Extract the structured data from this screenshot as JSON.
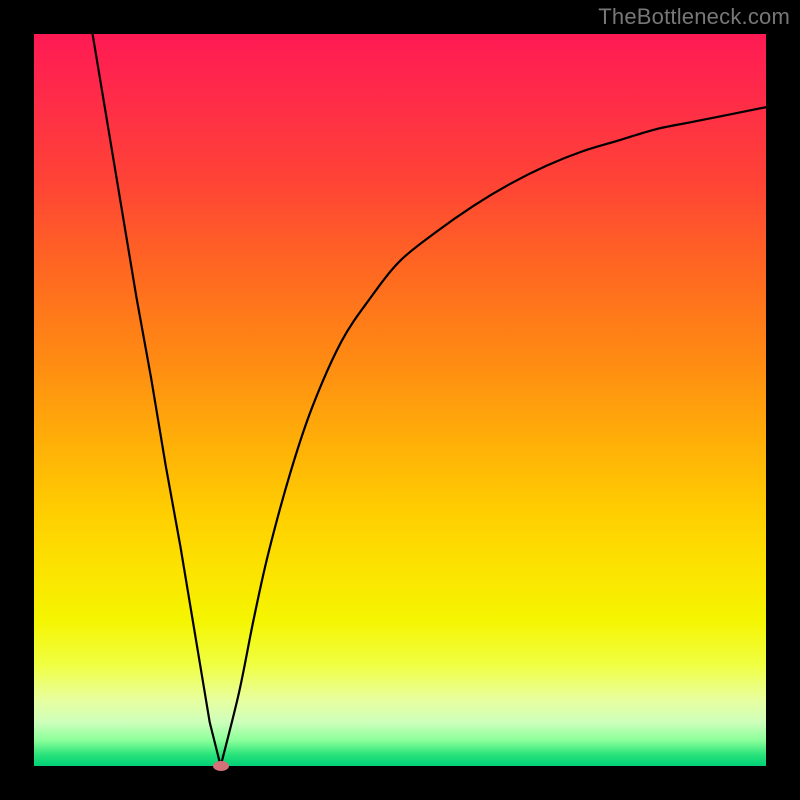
{
  "watermark": "TheBottleneck.com",
  "colors": {
    "frame": "#000000",
    "curve": "#000000",
    "dot": "#d5717a"
  },
  "chart_data": {
    "type": "line",
    "title": "",
    "xlabel": "",
    "ylabel": "",
    "xlim": [
      0,
      100
    ],
    "ylim": [
      0,
      100
    ],
    "grid": false,
    "legend": false,
    "series": [
      {
        "name": "left-branch",
        "x": [
          8,
          10,
          12,
          14,
          16,
          18,
          20,
          22,
          24,
          25.5
        ],
        "y": [
          100,
          88,
          76,
          64,
          53,
          41,
          30,
          18,
          6,
          0
        ]
      },
      {
        "name": "right-branch",
        "x": [
          25.5,
          28,
          30,
          32,
          35,
          38,
          42,
          46,
          50,
          55,
          60,
          65,
          70,
          75,
          80,
          85,
          90,
          95,
          100
        ],
        "y": [
          0,
          10,
          20,
          29,
          40,
          49,
          58,
          64,
          69,
          73,
          76.5,
          79.5,
          82,
          84,
          85.5,
          87,
          88,
          89,
          90
        ]
      }
    ],
    "marker": {
      "x": 25.5,
      "y": 0,
      "label": "vertex-dot"
    },
    "x_ticks": [],
    "y_ticks": [],
    "annotations": []
  }
}
